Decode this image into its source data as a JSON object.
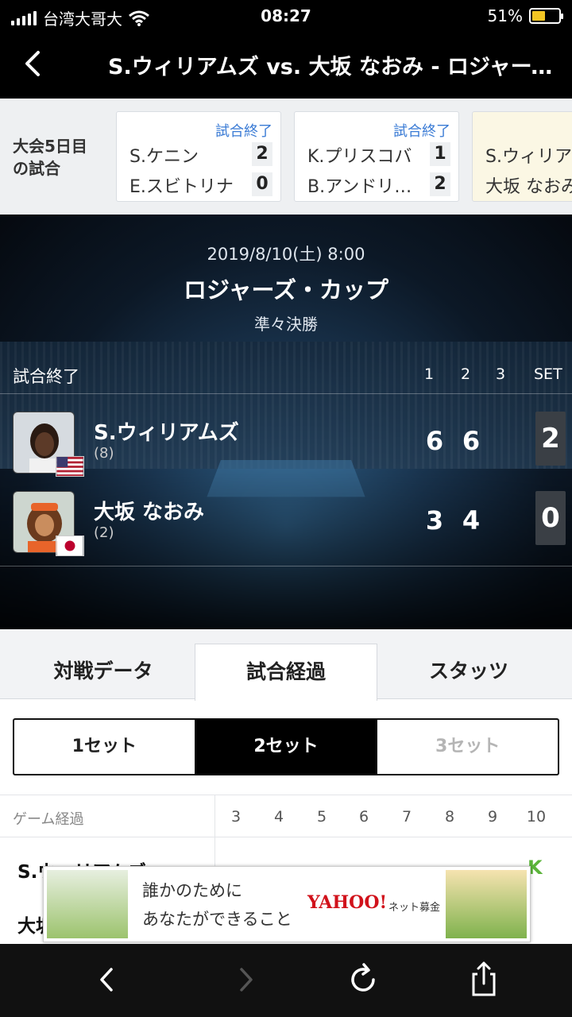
{
  "status_bar": {
    "carrier": "台湾大哥大",
    "time": "08:27",
    "battery_percent": "51%",
    "battery_level": 0.51
  },
  "nav": {
    "title": "S.ウィリアムズ vs. 大坂 なおみ - ロジャーズ・カップ"
  },
  "strip": {
    "day_label_1": "大会5日目",
    "day_label_2": "の試合",
    "matches": [
      {
        "status": "試合終了",
        "p1": "S.ケニン",
        "s1": "2",
        "p2": "E.スビトリナ",
        "s2": "0"
      },
      {
        "status": "試合終了",
        "p1": "K.プリスコバ",
        "s1": "1",
        "p2": "B.アンドリ…",
        "s2": "2"
      },
      {
        "status": "",
        "p1": "S.ウィリアムズ",
        "s1": "",
        "p2": "大坂 なおみ",
        "s2": ""
      }
    ]
  },
  "match": {
    "datetime": "2019/8/10(土) 8:00",
    "tournament": "ロジャーズ・カップ",
    "round": "準々決勝",
    "status": "試合終了",
    "columns": [
      "1",
      "2",
      "3",
      "SET"
    ],
    "players": [
      {
        "name": "S.ウィリアムズ",
        "seed": "(8)",
        "set1": "6",
        "set2": "6",
        "set3": "",
        "sets": "2",
        "flag": "usa-flag"
      },
      {
        "name": "大坂 なおみ",
        "seed": "(2)",
        "set1": "3",
        "set2": "4",
        "set3": "",
        "sets": "0",
        "flag": "japan-flag"
      }
    ]
  },
  "tabs": [
    "対戦データ",
    "試合経過",
    "スタッツ"
  ],
  "active_tab": "試合経過",
  "set_selector": [
    "1セット",
    "2セット",
    "3セット"
  ],
  "game_table": {
    "label": "ゲーム経過",
    "games": [
      "3",
      "4",
      "5",
      "6",
      "7",
      "8",
      "9",
      "10"
    ],
    "row1_name": "S.ウィリアムズ",
    "row2_name": "大坂 なおみ",
    "row1_last_mark": "K"
  },
  "ad": {
    "line1": "誰かのために",
    "line2": "あなたができること",
    "logo": "YAHOO!",
    "logo_sub": "ネット募金"
  },
  "colors": {
    "accent_blue": "#3a7bd5",
    "active_card_bg": "#fbf7e4",
    "game_mark_green": "#5bb43a",
    "battery_yellow": "#f3c623"
  }
}
